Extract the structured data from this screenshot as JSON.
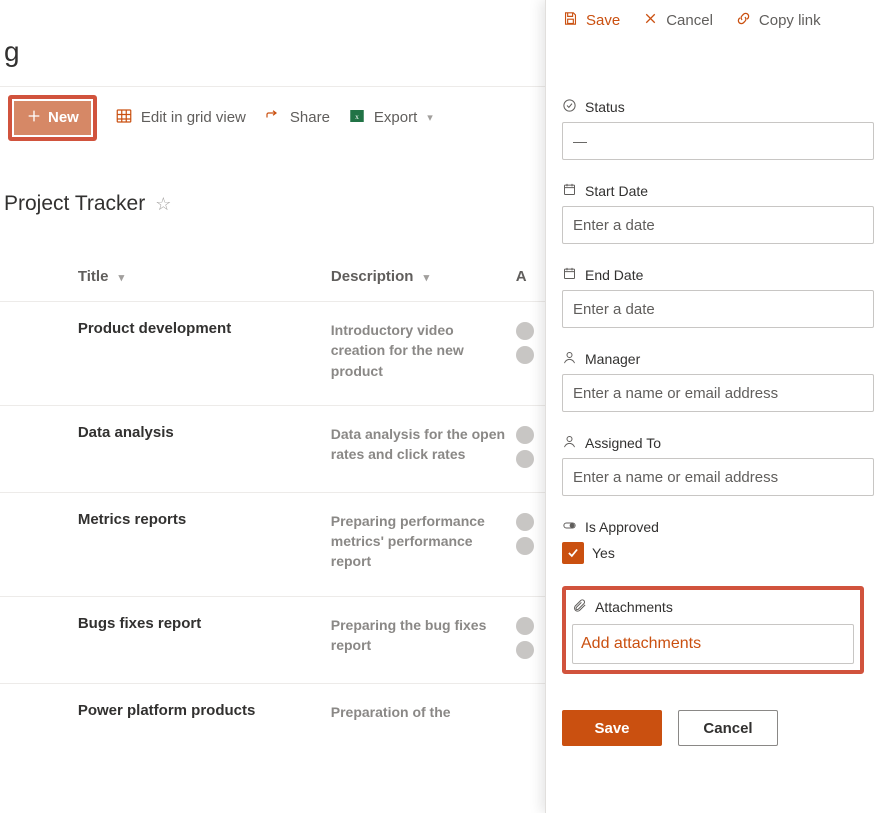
{
  "breadcrumb_fragment": "ɡ",
  "toolbar": {
    "new_label": "New",
    "edit_grid_label": "Edit in grid view",
    "share_label": "Share",
    "export_label": "Export"
  },
  "list": {
    "title": "Project Tracker",
    "columns": {
      "title": "Title",
      "description": "Description",
      "extra": "A"
    },
    "rows": [
      {
        "title": "Product development",
        "description": "Introductory video creation for the new product"
      },
      {
        "title": "Data analysis",
        "description": "Data analysis for the open rates and click rates"
      },
      {
        "title": "Metrics reports",
        "description": "Preparing performance metrics' performance report"
      },
      {
        "title": "Bugs fixes report",
        "description": "Preparing the bug fixes report"
      },
      {
        "title": "Power platform products",
        "description": "Preparation of the"
      }
    ]
  },
  "panel": {
    "actions": {
      "save": "Save",
      "cancel": "Cancel",
      "copy_link": "Copy link"
    },
    "status": {
      "label": "Status",
      "value": "—"
    },
    "start_date": {
      "label": "Start Date",
      "placeholder": "Enter a date"
    },
    "end_date": {
      "label": "End Date",
      "placeholder": "Enter a date"
    },
    "manager": {
      "label": "Manager",
      "placeholder": "Enter a name or email address"
    },
    "assigned": {
      "label": "Assigned To",
      "placeholder": "Enter a name or email address"
    },
    "approved": {
      "label": "Is Approved",
      "value": "Yes"
    },
    "attachments": {
      "label": "Attachments",
      "link": "Add attachments"
    },
    "footer": {
      "save": "Save",
      "cancel": "Cancel"
    }
  }
}
